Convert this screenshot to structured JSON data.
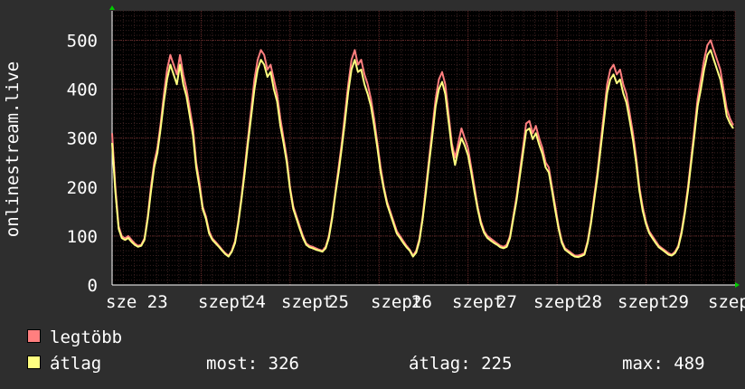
{
  "chart_data": {
    "type": "line",
    "ylabel": "onlinestream.live",
    "yticks": [
      0,
      100,
      200,
      300,
      400,
      500
    ],
    "ylim": [
      0,
      560
    ],
    "xticks": [
      "sze 23",
      "szept",
      "24",
      "szept",
      "25",
      "szept",
      "26",
      "szept",
      "27",
      "szept",
      "28",
      "szept",
      "29",
      "szept"
    ],
    "grid": true,
    "background": "#000000",
    "series": [
      {
        "name": "legtöbb",
        "color": "#ff7f7f",
        "values": [
          310,
          200,
          120,
          100,
          95,
          100,
          92,
          85,
          80,
          82,
          95,
          140,
          200,
          250,
          280,
          330,
          390,
          440,
          470,
          450,
          430,
          470,
          430,
          400,
          360,
          320,
          250,
          210,
          160,
          140,
          110,
          95,
          88,
          80,
          72,
          65,
          60,
          70,
          90,
          130,
          180,
          240,
          300,
          360,
          420,
          460,
          480,
          470,
          440,
          450,
          420,
          390,
          340,
          300,
          260,
          200,
          160,
          140,
          120,
          100,
          85,
          80,
          78,
          75,
          72,
          70,
          78,
          100,
          140,
          190,
          240,
          290,
          350,
          410,
          460,
          480,
          450,
          460,
          430,
          410,
          380,
          340,
          290,
          240,
          200,
          170,
          150,
          130,
          110,
          100,
          90,
          80,
          72,
          60,
          70,
          95,
          140,
          200,
          260,
          320,
          380,
          420,
          435,
          410,
          350,
          290,
          260,
          290,
          320,
          300,
          280,
          240,
          200,
          160,
          130,
          110,
          100,
          95,
          90,
          85,
          80,
          78,
          82,
          100,
          140,
          180,
          230,
          280,
          330,
          335,
          310,
          325,
          300,
          280,
          250,
          240,
          200,
          160,
          120,
          90,
          75,
          70,
          65,
          60,
          60,
          62,
          65,
          90,
          130,
          180,
          230,
          290,
          350,
          410,
          440,
          450,
          430,
          440,
          410,
          390,
          350,
          310,
          260,
          200,
          160,
          130,
          110,
          100,
          90,
          80,
          75,
          70,
          65,
          62,
          68,
          80,
          110,
          150,
          200,
          260,
          320,
          380,
          420,
          460,
          490,
          500,
          480,
          460,
          440,
          400,
          360,
          340,
          326
        ]
      },
      {
        "name": "átlag",
        "color": "#ffff80",
        "values": [
          290,
          190,
          115,
          96,
          92,
          96,
          88,
          82,
          78,
          80,
          92,
          135,
          190,
          240,
          270,
          320,
          375,
          420,
          450,
          430,
          410,
          450,
          410,
          385,
          345,
          305,
          240,
          200,
          155,
          135,
          105,
          92,
          85,
          78,
          70,
          63,
          58,
          68,
          86,
          125,
          175,
          230,
          290,
          345,
          400,
          440,
          460,
          450,
          425,
          435,
          400,
          375,
          325,
          290,
          250,
          195,
          155,
          135,
          115,
          96,
          82,
          77,
          75,
          72,
          70,
          68,
          75,
          96,
          135,
          185,
          230,
          280,
          335,
          395,
          440,
          460,
          435,
          440,
          410,
          390,
          365,
          325,
          280,
          230,
          195,
          165,
          145,
          125,
          105,
          96,
          86,
          77,
          70,
          58,
          66,
          90,
          135,
          190,
          250,
          305,
          365,
          400,
          415,
          390,
          335,
          280,
          245,
          275,
          300,
          285,
          265,
          230,
          190,
          155,
          125,
          106,
          96,
          91,
          86,
          82,
          77,
          75,
          78,
          96,
          135,
          172,
          220,
          268,
          315,
          320,
          298,
          310,
          287,
          268,
          240,
          230,
          192,
          152,
          115,
          86,
          72,
          67,
          62,
          58,
          57,
          59,
          62,
          86,
          125,
          172,
          220,
          278,
          335,
          392,
          420,
          430,
          412,
          420,
          392,
          372,
          335,
          296,
          248,
          192,
          152,
          125,
          106,
          96,
          86,
          77,
          72,
          67,
          62,
          60,
          65,
          77,
          105,
          144,
          192,
          250,
          307,
          365,
          400,
          440,
          470,
          480,
          460,
          440,
          420,
          385,
          345,
          330,
          320
        ]
      }
    ],
    "stats": [
      {
        "label": "most:",
        "value": "326"
      },
      {
        "label": "átlag:",
        "value": "225"
      },
      {
        "label": "max:",
        "value": "489"
      }
    ]
  }
}
